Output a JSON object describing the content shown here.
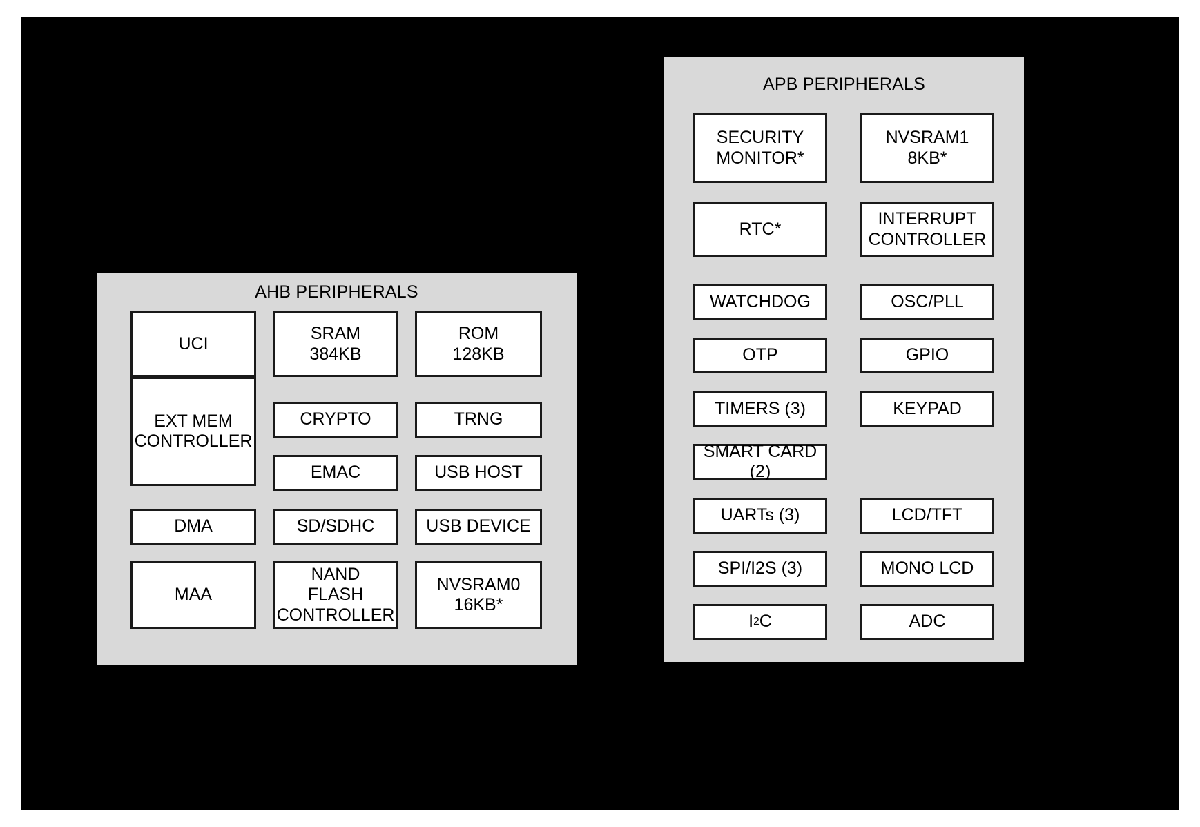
{
  "canvas": {
    "background_color": "#000000",
    "frame_color": "#ffffff",
    "panel_color": "#d9d9d9",
    "block_fill": "#ffffff",
    "block_border": "#1a1a1a"
  },
  "ahb_panel": {
    "title": "AHB PERIPHERALS",
    "blocks": [
      {
        "id": "uci",
        "label": "UCI"
      },
      {
        "id": "ext-mem-ctrl",
        "label": "EXT MEM\nCONTROLLER"
      },
      {
        "id": "dma",
        "label": "DMA"
      },
      {
        "id": "maa",
        "label": "MAA"
      },
      {
        "id": "sram",
        "label": "SRAM\n384KB"
      },
      {
        "id": "crypto",
        "label": "CRYPTO"
      },
      {
        "id": "emac",
        "label": "EMAC"
      },
      {
        "id": "sd-sdhc",
        "label": "SD/SDHC"
      },
      {
        "id": "nand-flash-ctrl",
        "label": "NAND\nFLASH\nCONTROLLER"
      },
      {
        "id": "rom",
        "label": "ROM\n128KB"
      },
      {
        "id": "trng",
        "label": "TRNG"
      },
      {
        "id": "usb-host",
        "label": "USB HOST"
      },
      {
        "id": "usb-device",
        "label": "USB DEVICE"
      },
      {
        "id": "nvsram0",
        "label": "NVSRAM0\n16KB*"
      }
    ]
  },
  "apb_panel": {
    "title": "APB PERIPHERALS",
    "blocks": [
      {
        "id": "security-monitor",
        "label": "SECURITY\nMONITOR*"
      },
      {
        "id": "rtc",
        "label": "RTC*"
      },
      {
        "id": "watchdog",
        "label": "WATCHDOG"
      },
      {
        "id": "otp",
        "label": "OTP"
      },
      {
        "id": "timers",
        "label": "TIMERS (3)"
      },
      {
        "id": "smart-card",
        "label": "SMART CARD (2)"
      },
      {
        "id": "uarts",
        "label": "UARTs (3)"
      },
      {
        "id": "spi-i2s",
        "label": "SPI/I2S (3)"
      },
      {
        "id": "i2c",
        "label": "I2C",
        "label_main": "I",
        "label_sup": "2",
        "label_tail": "C"
      },
      {
        "id": "nvsram1",
        "label": "NVSRAM1\n8KB*"
      },
      {
        "id": "interrupt-controller",
        "label": "INTERRUPT\nCONTROLLER"
      },
      {
        "id": "osc-pll",
        "label": "OSC/PLL"
      },
      {
        "id": "gpio",
        "label": "GPIO"
      },
      {
        "id": "keypad",
        "label": "KEYPAD"
      },
      {
        "id": "lcd-tft",
        "label": "LCD/TFT"
      },
      {
        "id": "mono-lcd",
        "label": "MONO LCD"
      },
      {
        "id": "adc",
        "label": "ADC"
      }
    ]
  }
}
